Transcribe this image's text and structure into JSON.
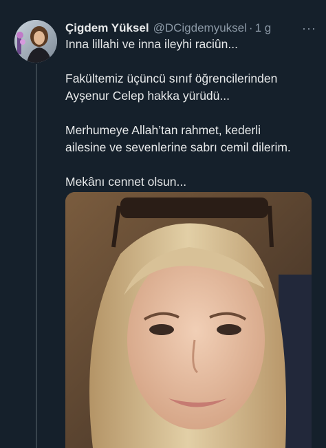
{
  "tweet": {
    "author_name": "Çigdem Yüksel",
    "handle": "@DCigdemyuksel",
    "separator": "·",
    "time": "1 g",
    "more_icon": "···",
    "paragraphs": [
      "Inna lillahi ve inna ileyhi raciûn...",
      "Fakültemiz üçüncü sınıf öğrencilerinden\nAyşenur Celep hakka yürüdü...",
      "Merhumeye Allah’tan rahmet, kederli\nailesine ve sevenlerine sabrı cemil dilerim.",
      "Mekânı cennet olsun..."
    ]
  },
  "colors": {
    "background": "#15202b",
    "text": "#e7e9ea",
    "secondary": "#8b98a5",
    "thread_line": "#38444d"
  }
}
